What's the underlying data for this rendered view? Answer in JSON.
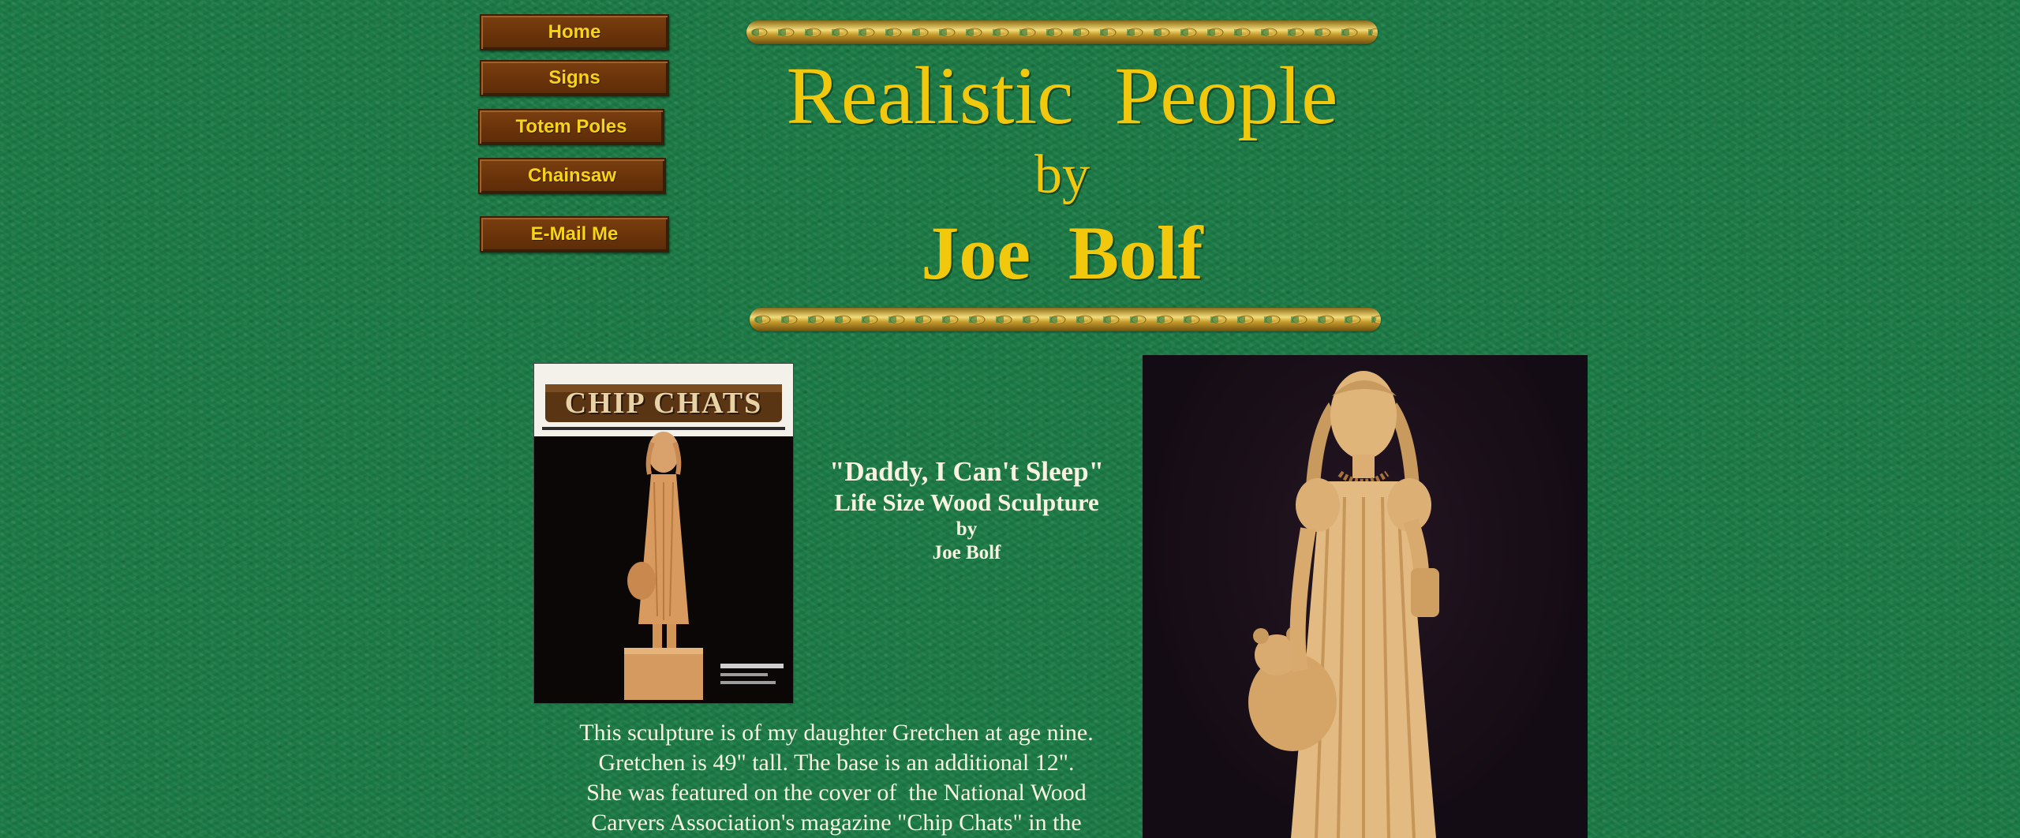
{
  "nav": {
    "home": "Home",
    "signs": "Signs",
    "totem_poles": "Totem Poles",
    "chainsaw": "Chainsaw",
    "email": "E-Mail Me"
  },
  "header": {
    "title": "Realistic  People",
    "by": "by",
    "author": "Joe  Bolf"
  },
  "magazine": {
    "masthead": "CHIP CHATS"
  },
  "caption": {
    "title": "\"Daddy, I Can't Sleep\"",
    "subtitle": "Life Size Wood Sculpture",
    "by": "by",
    "author": "Joe Bolf"
  },
  "description": {
    "line1": "This sculpture is of my daughter Gretchen at age nine.",
    "line2": "Gretchen is 49\" tall. The base is an additional 12\".",
    "line3": "She was featured on the cover of  the National Wood",
    "line4": "Carvers Association's magazine \"Chip Chats\" in the"
  },
  "colors": {
    "background": "#1b7a45",
    "button": "#6b340a",
    "button_text": "#f7d417",
    "title": "#f2c80d",
    "text": "#f7f3e0"
  }
}
